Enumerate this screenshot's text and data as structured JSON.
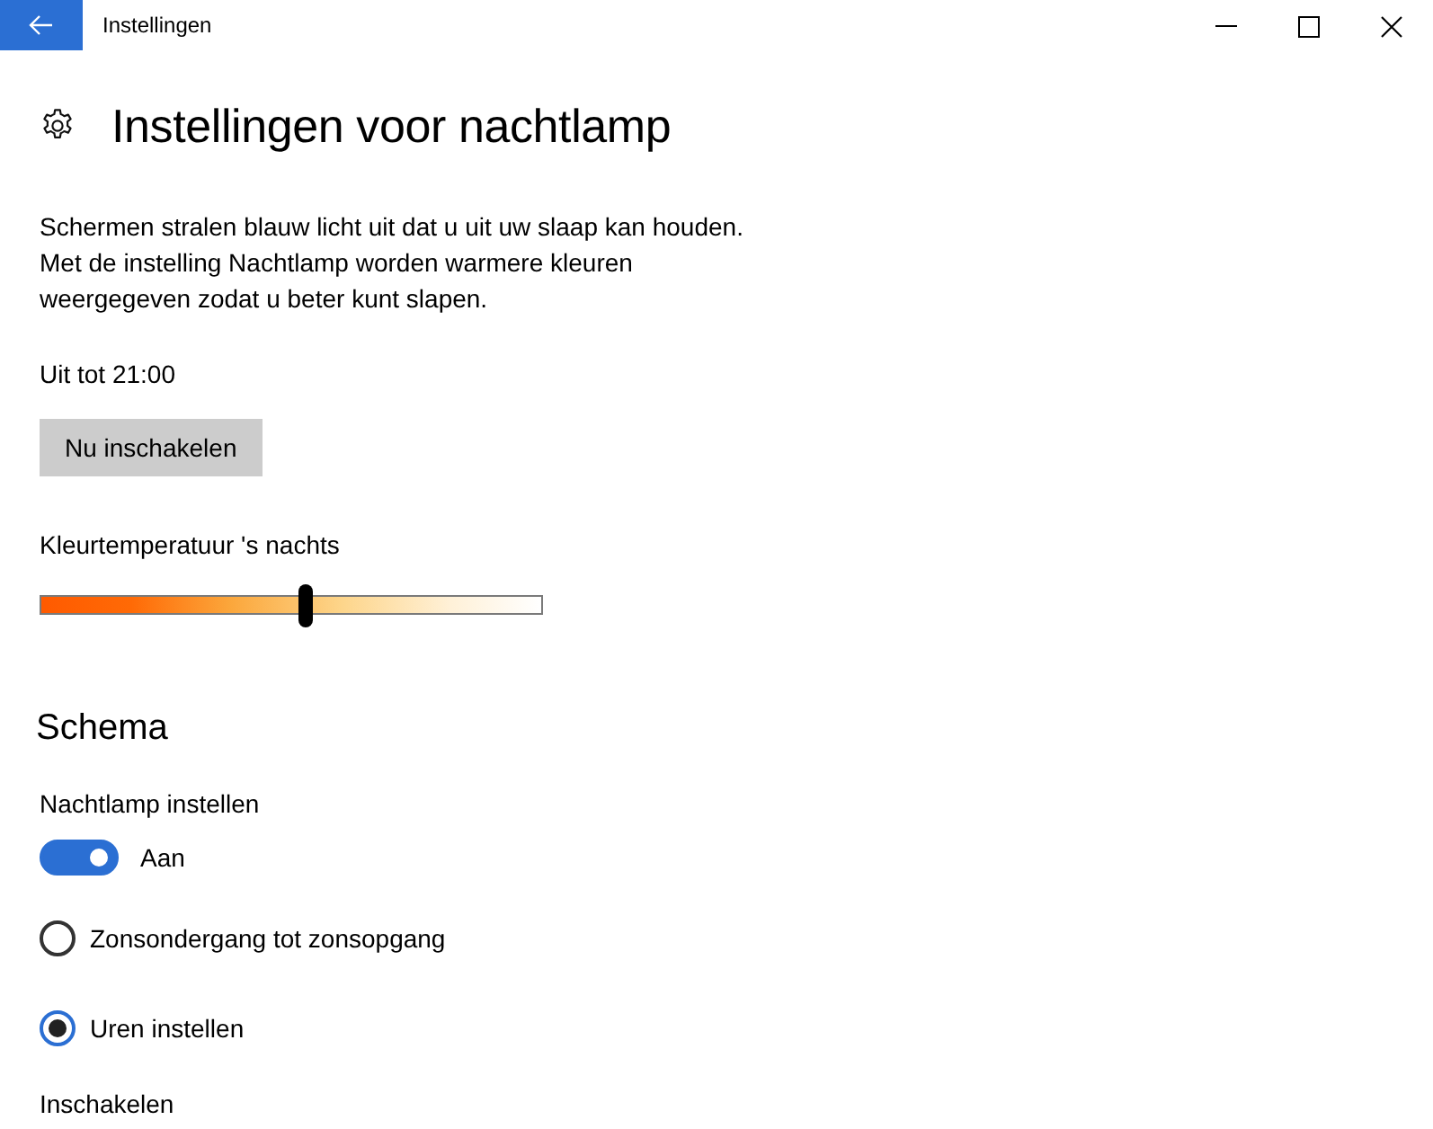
{
  "window": {
    "title": "Instellingen"
  },
  "page": {
    "title": "Instellingen voor nachtlamp",
    "description": "Schermen stralen blauw licht uit dat u uit uw slaap kan houden.\nMet de instelling Nachtlamp worden warmere kleuren\nweergegeven zodat u beter kunt slapen.",
    "status": "Uit tot 21:00",
    "button": "Nu inschakelen",
    "slider": {
      "label": "Kleurtemperatuur 's nachts",
      "level": 0.53
    }
  },
  "schedule": {
    "title": "Schema",
    "toggle": {
      "label": "Nachtlamp instellen",
      "on": true,
      "state_text": "Aan"
    },
    "options": [
      {
        "label": "Zonsondergang tot zonsopgang",
        "selected": false
      },
      {
        "label": "Uren instellen",
        "selected": true
      }
    ],
    "next_label": "Inschakelen"
  }
}
